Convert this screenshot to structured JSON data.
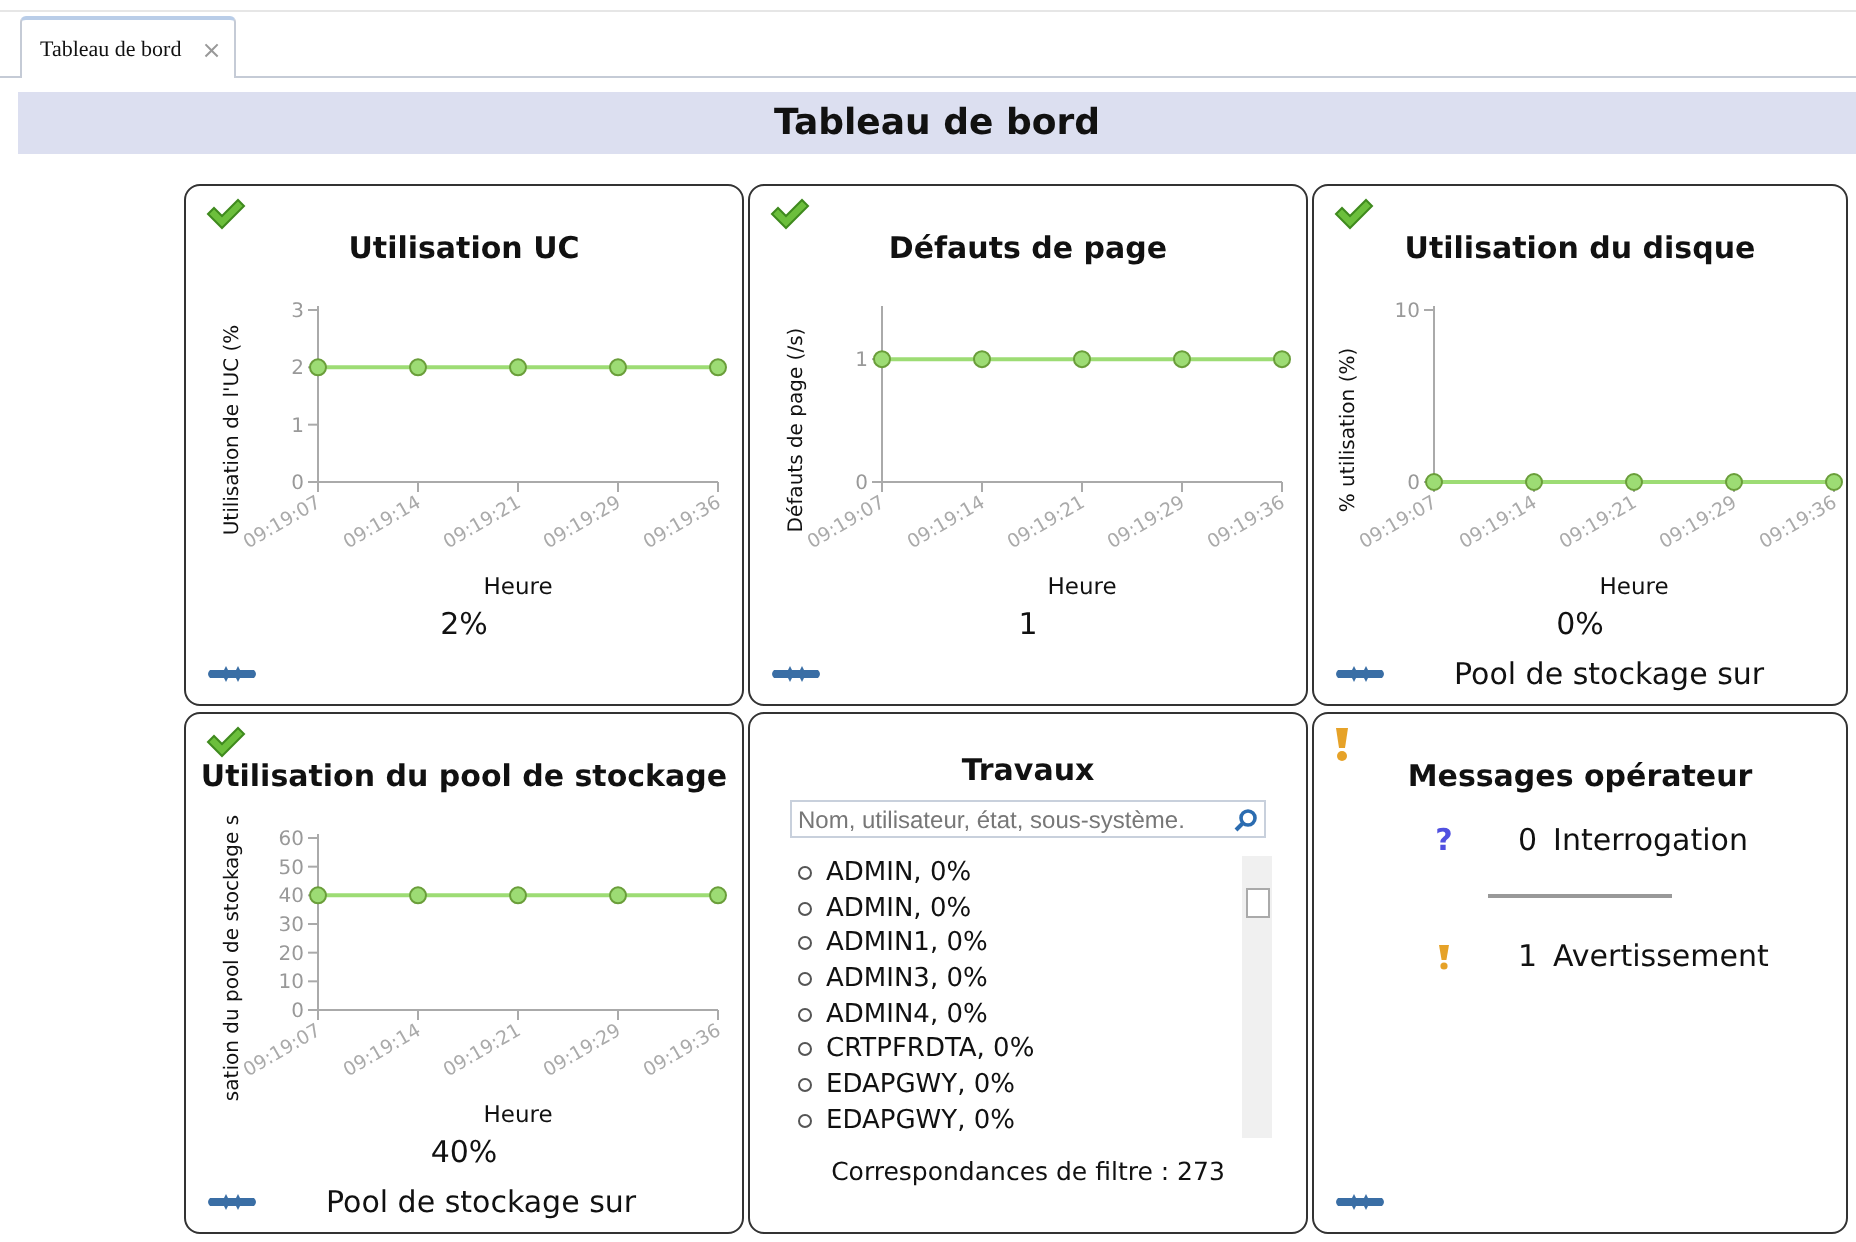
{
  "tabs": [
    {
      "label": "Tableau de bord",
      "close": "×",
      "selected": true
    }
  ],
  "header": {
    "title": "Tableau de bord"
  },
  "cards": [
    {
      "kind": "chart",
      "status": {
        "kind": "ok"
      },
      "title": "Utilisation UC",
      "chart_data": {
        "type": "line",
        "xlabel": "Heure",
        "ylabel": "Utilisation de l'UC (%",
        "categories": [
          "09:19:07",
          "09:19:14",
          "09:19:21",
          "09:19:29",
          "09:19:36"
        ],
        "series": [
          {
            "color": "#9ddc74",
            "marker": "circle",
            "values": [
              2,
              2,
              2,
              2,
              2
            ]
          }
        ],
        "ylim": [
          0,
          3
        ],
        "yticks": [
          0,
          1,
          2,
          3
        ]
      },
      "value": "2%",
      "footer_icon": true
    },
    {
      "kind": "chart",
      "status": {
        "kind": "ok"
      },
      "title": "Défauts de page",
      "chart_data": {
        "type": "line",
        "xlabel": "Heure",
        "ylabel": "Défauts de page (/s)",
        "categories": [
          "09:19:07",
          "09:19:14",
          "09:19:21",
          "09:19:29",
          "09:19:36"
        ],
        "series": [
          {
            "color": "#9ddc74",
            "marker": "circle",
            "values": [
              1,
              1,
              1,
              1,
              1
            ]
          }
        ],
        "ylim": [
          0,
          1.4
        ],
        "yticks": [
          0,
          1
        ]
      },
      "value": "1",
      "footer_icon": true
    },
    {
      "kind": "chart",
      "status": {
        "kind": "ok"
      },
      "title": "Utilisation du disque",
      "chart_data": {
        "type": "line",
        "xlabel": "Heure",
        "ylabel": "% utilisation (%)",
        "categories": [
          "09:19:07",
          "09:19:14",
          "09:19:21",
          "09:19:29",
          "09:19:36"
        ],
        "series": [
          {
            "color": "#9ddc74",
            "marker": "circle",
            "values": [
              0,
              0,
              0,
              0,
              0
            ]
          }
        ],
        "ylim": [
          0,
          10
        ],
        "yticks": [
          0,
          10
        ]
      },
      "value": "0%",
      "footer_icon": true,
      "note": "Pool de stockage sur"
    },
    {
      "kind": "chart",
      "status": {
        "kind": "ok"
      },
      "title": "Utilisation du pool de stockage",
      "chart_data": {
        "type": "line",
        "xlabel": "Heure",
        "ylabel": "sation du pool de stockage s",
        "categories": [
          "09:19:07",
          "09:19:14",
          "09:19:21",
          "09:19:29",
          "09:19:36"
        ],
        "series": [
          {
            "color": "#9ddc74",
            "marker": "circle",
            "values": [
              40,
              40,
              40,
              40,
              40
            ]
          }
        ],
        "ylim": [
          0,
          60
        ],
        "yticks": [
          0,
          10,
          20,
          30,
          40,
          50,
          60
        ]
      },
      "value": "40%",
      "footer_icon": true,
      "note": "Pool de stockage sur"
    },
    {
      "kind": "jobs",
      "title": "Travaux",
      "search": {
        "placeholder": "Nom, utilisateur, état, sous-système."
      },
      "items": [
        "ADMIN, 0%",
        "ADMIN, 0%",
        "ADMIN1, 0%",
        "ADMIN3, 0%",
        "ADMIN4, 0%",
        "CRTPFRDTA, 0%",
        "EDAPGWY, 0%",
        "EDAPGWY, 0%"
      ],
      "footer": "Correspondances de filtre : 273"
    },
    {
      "kind": "messages",
      "status": {
        "kind": "warning"
      },
      "title": "Messages opérateur",
      "rows": [
        {
          "kind": "question",
          "icon": "?",
          "count": "0",
          "label": "Interrogation"
        },
        {
          "kind": "warning",
          "count": "1",
          "label": "Avertissement"
        }
      ],
      "footer_icon": true
    }
  ]
}
